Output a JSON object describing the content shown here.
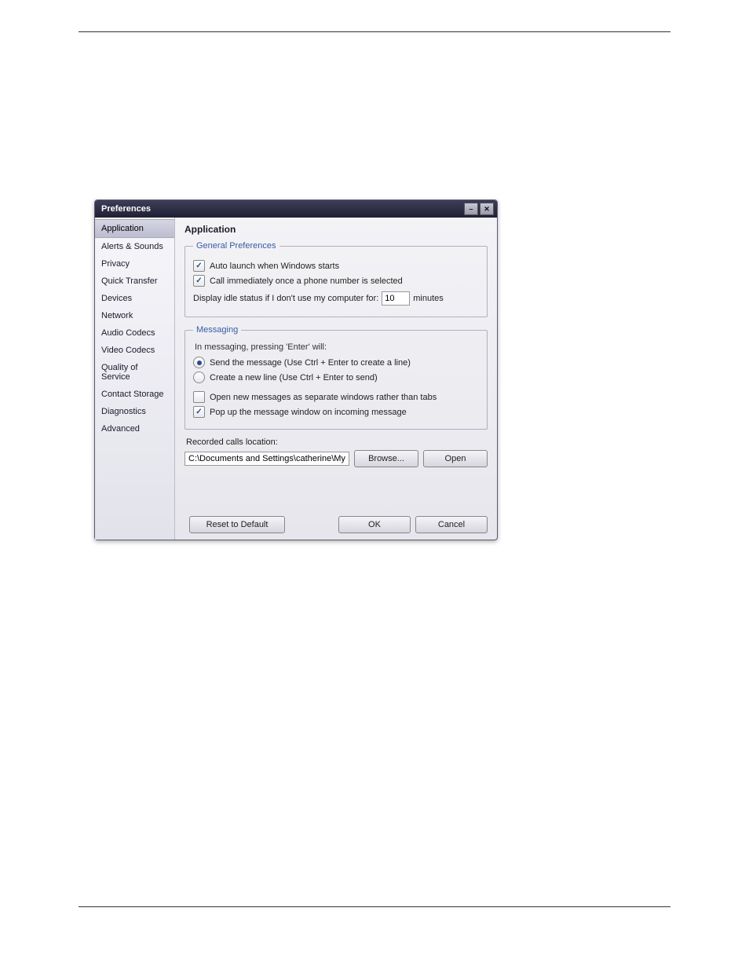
{
  "dialog": {
    "title": "Preferences"
  },
  "sidebar": {
    "items": [
      {
        "label": "Application",
        "selected": true
      },
      {
        "label": "Alerts & Sounds",
        "selected": false
      },
      {
        "label": "Privacy",
        "selected": false
      },
      {
        "label": "Quick Transfer",
        "selected": false
      },
      {
        "label": "Devices",
        "selected": false
      },
      {
        "label": "Network",
        "selected": false
      },
      {
        "label": "Audio Codecs",
        "selected": false
      },
      {
        "label": "Video Codecs",
        "selected": false
      },
      {
        "label": "Quality of Service",
        "selected": false
      },
      {
        "label": "Contact Storage",
        "selected": false
      },
      {
        "label": "Diagnostics",
        "selected": false
      },
      {
        "label": "Advanced",
        "selected": false
      }
    ]
  },
  "panel": {
    "title": "Application",
    "general": {
      "legend": "General Preferences",
      "auto_launch": {
        "label": "Auto launch when Windows starts",
        "checked": true
      },
      "call_immediately": {
        "label": "Call immediately once a phone number is selected",
        "checked": true
      },
      "idle_prefix": "Display idle status if I don't use my computer for:",
      "idle_value": "10",
      "idle_suffix": "minutes"
    },
    "messaging": {
      "legend": "Messaging",
      "intro": "In messaging, pressing 'Enter' will:",
      "radio_send": {
        "label": "Send the message (Use Ctrl + Enter to create a line)",
        "selected": true
      },
      "radio_newline": {
        "label": "Create a new line (Use Ctrl + Enter to send)",
        "selected": false
      },
      "separate_windows": {
        "label": "Open new messages as separate windows rather than tabs",
        "checked": false
      },
      "popup": {
        "label": "Pop up the message window on incoming message",
        "checked": true
      }
    },
    "recorded": {
      "label": "Recorded calls location:",
      "path": "C:\\Documents and Settings\\catherine\\My Docume",
      "browse": "Browse...",
      "open": "Open"
    },
    "footer": {
      "reset": "Reset to Default",
      "ok": "OK",
      "cancel": "Cancel"
    }
  }
}
